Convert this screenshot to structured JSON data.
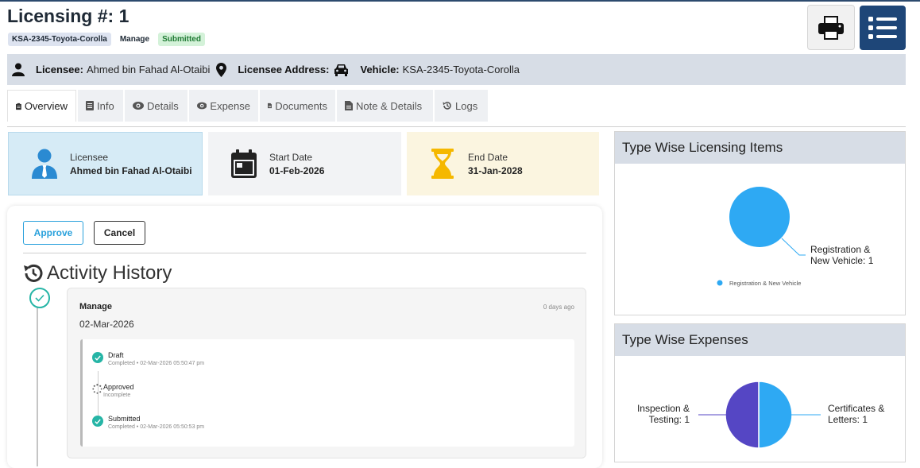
{
  "header": {
    "title": "Licensing #: 1",
    "badge_vehicle": "KSA-2345-Toyota-Corolla",
    "badge_manage": "Manage",
    "badge_status": "Submitted"
  },
  "infobar": {
    "licensee_label": "Licensee:",
    "licensee_value": "Ahmed bin Fahad Al-Otaibi",
    "address_label": "Licensee Address:",
    "address_value": "",
    "vehicle_label": "Vehicle:",
    "vehicle_value": "KSA-2345-Toyota-Corolla"
  },
  "tabs": [
    {
      "label": "Overview",
      "icon": "clipboard-icon"
    },
    {
      "label": "Info",
      "icon": "list-doc-icon"
    },
    {
      "label": "Details",
      "icon": "eye-icon"
    },
    {
      "label": "Expense",
      "icon": "eye-icon"
    },
    {
      "label": "Documents",
      "icon": "document-icon"
    },
    {
      "label": "Note & Details",
      "icon": "document-icon"
    },
    {
      "label": "Logs",
      "icon": "history-icon"
    }
  ],
  "cards": {
    "licensee": {
      "label": "Licensee",
      "value": "Ahmed bin Fahad Al-Otaibi",
      "bg": "#d6ebf6"
    },
    "start": {
      "label": "Start Date",
      "value": "01-Feb-2026",
      "bg": "#f2f3f5"
    },
    "end": {
      "label": "End Date",
      "value": "31-Jan-2028",
      "bg": "#fbf5e0"
    }
  },
  "actions": {
    "approve": "Approve",
    "cancel": "Cancel"
  },
  "history": {
    "title": "Activity History",
    "entry": {
      "title": "Manage",
      "ago": "0 days ago",
      "date": "02-Mar-2026",
      "steps": [
        {
          "name": "Draft",
          "meta": "Completed • 02-Mar-2026 05:50:47 pm"
        },
        {
          "name": "Approved",
          "meta": "Incomplete"
        },
        {
          "name": "Submitted",
          "meta": "Completed • 02-Mar-2026 05:50:53 pm"
        }
      ]
    }
  },
  "chart_data": [
    {
      "type": "pie",
      "title": "Type Wise Licensing Items",
      "categories": [
        "Registration & New Vehicle"
      ],
      "values": [
        1
      ],
      "colors": [
        "#2ea9f3"
      ],
      "labels": [
        "Registration & New Vehicle: 1"
      ],
      "legend": [
        "Registration & New Vehicle"
      ],
      "legend_position": "bottom"
    },
    {
      "type": "pie",
      "title": "Type Wise Expenses",
      "categories": [
        "Certificates & Letters",
        "Inspection & Testing"
      ],
      "values": [
        1,
        1
      ],
      "colors": [
        "#2ea9f3",
        "#5546c4"
      ],
      "labels": [
        "Certificates & Letters: 1",
        "Inspection & Testing: 1"
      ]
    }
  ],
  "colors": {
    "accent": "#1e4678",
    "teal": "#26b5a6",
    "approve": "#2aa1dc"
  }
}
